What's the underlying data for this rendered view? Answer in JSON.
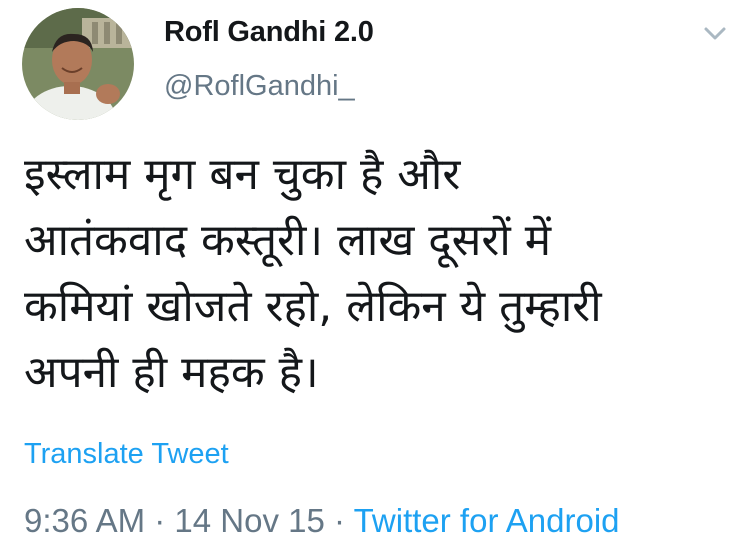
{
  "user": {
    "display_name": "Rofl Gandhi 2.0",
    "handle": "@RoflGandhi_"
  },
  "tweet": {
    "text": "इस्लाम मृग बन चुका है और\nआतंकवाद कस्तूरी। लाख दूसरों में\nकमियां खोजते रहो, लेकिन ये तुम्हारी\nअपनी ही महक है।",
    "translate_label": "Translate Tweet"
  },
  "meta": {
    "time": "9:36 AM",
    "separator": " · ",
    "date": "14 Nov 15",
    "source": "Twitter for Android"
  },
  "icons": {
    "caret": "chevron-down-icon",
    "avatar": "avatar"
  },
  "colors": {
    "link": "#1da1f2",
    "secondary_text": "#657786",
    "primary_text": "#14171a"
  }
}
